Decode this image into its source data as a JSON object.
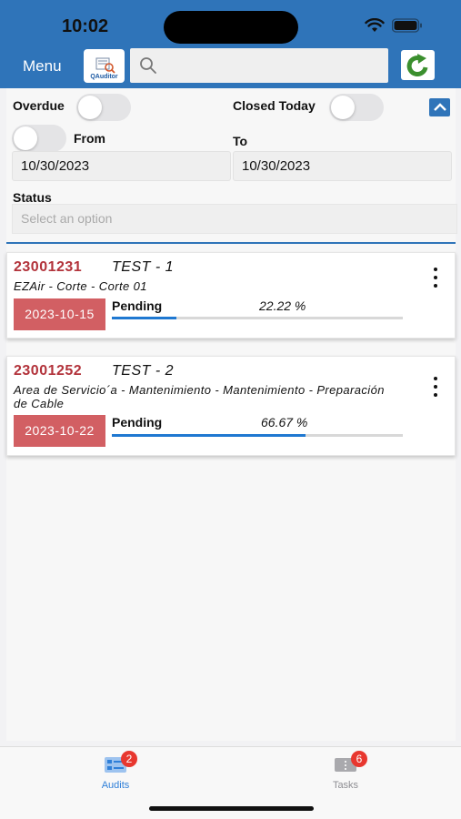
{
  "status_bar": {
    "time": "10:02"
  },
  "header": {
    "menu_label": "Menu",
    "logo_text": "QAuditor",
    "search": {
      "placeholder": ""
    }
  },
  "filters": {
    "overdue_label": "Overdue",
    "closed_today_label": "Closed Today",
    "from_label": "From",
    "to_label": "To",
    "from_date": "10/30/2023",
    "to_date": "10/30/2023",
    "status_label": "Status",
    "status_placeholder": "Select an option",
    "overdue_on": false,
    "closed_today_on": false,
    "range_on": false
  },
  "audits": [
    {
      "id": "23001231",
      "name": "TEST - 1",
      "description": "EZAir - Corte - Corte 01",
      "date": "2023-10-15",
      "status": "Pending",
      "percent_text": "22.22 %",
      "percent": 22.22
    },
    {
      "id": "23001252",
      "name": "TEST - 2",
      "description": "Area de Servicio´a - Mantenimiento - Mantenimiento - Preparación de Cable",
      "date": "2023-10-22",
      "status": "Pending",
      "percent_text": "66.67 %",
      "percent": 66.67
    }
  ],
  "tabs": [
    {
      "label": "Audits",
      "badge": "2",
      "active": true,
      "icon": "audits-icon"
    },
    {
      "label": "Tasks",
      "badge": "6",
      "active": false,
      "icon": "tasks-icon"
    }
  ],
  "colors": {
    "header": "#2f74b9",
    "date_badge": "#d25f63",
    "id_text": "#b2323a",
    "progress": "#1f78d1",
    "tab_active": "#2f7fd8",
    "tab_inactive": "#8e8e93",
    "badge": "#e8372f"
  }
}
